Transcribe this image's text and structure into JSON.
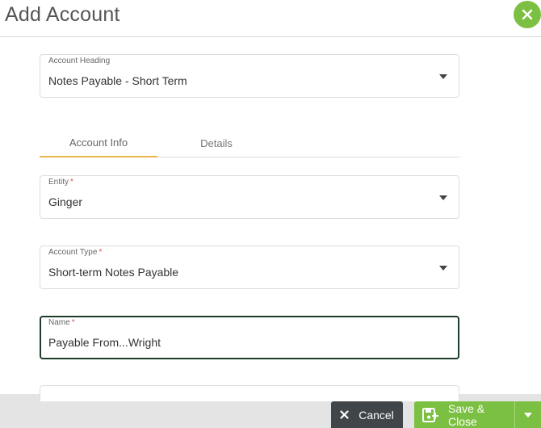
{
  "header": {
    "title": "Add Account"
  },
  "icons": {
    "close": "close-icon",
    "cancel": "x-icon",
    "save": "save-disk-icon",
    "dropdown": "caret-down-icon"
  },
  "colors": {
    "accent": "#7cc043",
    "dark": "#3f4548",
    "tab_active": "#e6b84c",
    "field_active_border": "#1f3d2b"
  },
  "fields": {
    "account_heading": {
      "label": "Account Heading",
      "value": "Notes Payable - Short Term"
    },
    "entity": {
      "label": "Entity",
      "required": "*",
      "value": "Ginger"
    },
    "account_type": {
      "label": "Account Type",
      "required": "*",
      "value": "Short-term Notes Payable"
    },
    "name": {
      "label": "Name",
      "required": "*",
      "value": "Payable From...Wright"
    }
  },
  "tabs": [
    {
      "label": "Account Info",
      "active": true
    },
    {
      "label": "Details",
      "active": false
    }
  ],
  "footer": {
    "cancel_label": "Cancel",
    "save_label": "Save & Close"
  }
}
